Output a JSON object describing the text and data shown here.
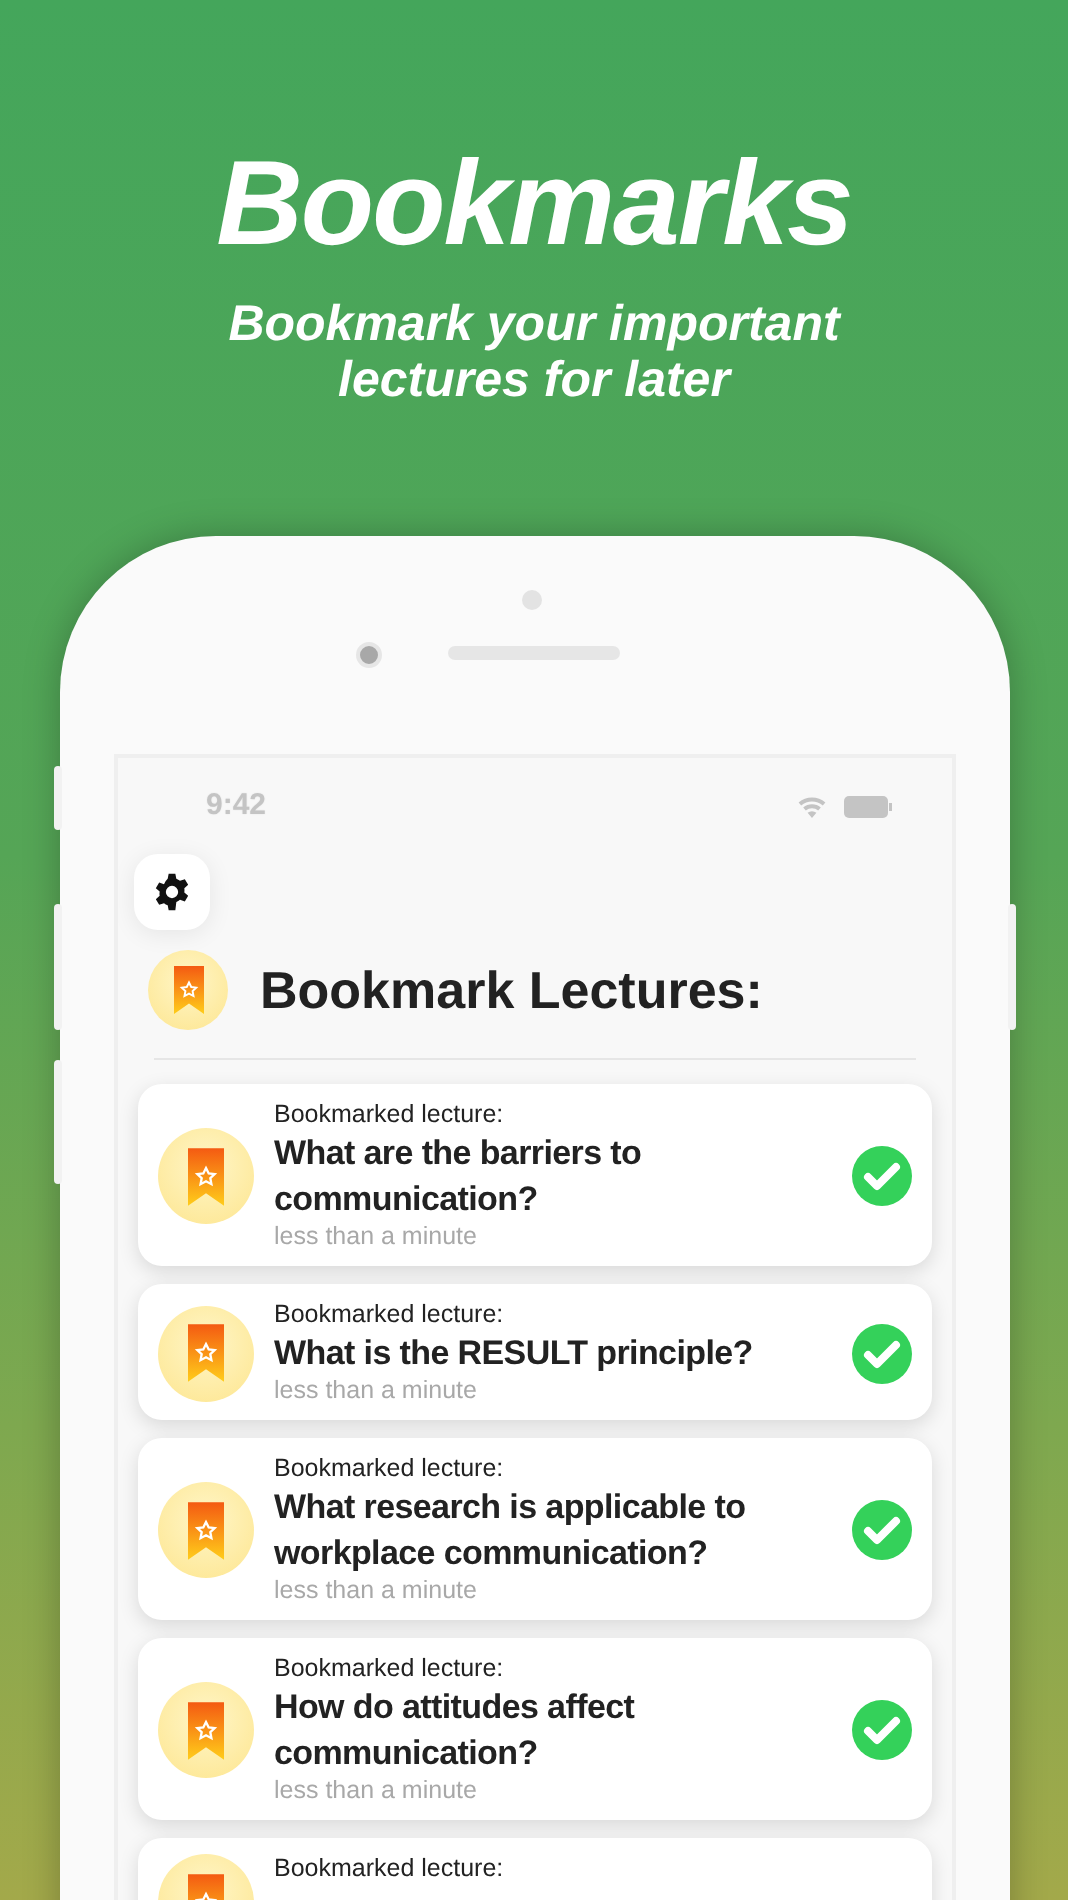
{
  "header": {
    "title": "Bookmarks",
    "subtitle": "Bookmark your important lectures for later"
  },
  "status_bar": {
    "time": "9:42"
  },
  "screen": {
    "title": "Bookmark Lectures:"
  },
  "lectures": [
    {
      "label": "Bookmarked lecture:",
      "title": "What are the barriers to communication?",
      "time": "less than a minute",
      "completed": true
    },
    {
      "label": "Bookmarked lecture:",
      "title": "What is the RESULT principle?",
      "time": "less than a minute",
      "completed": true
    },
    {
      "label": "Bookmarked lecture:",
      "title": "What research is applicable to workplace communication?",
      "time": "less than a minute",
      "completed": true
    },
    {
      "label": "Bookmarked lecture:",
      "title": "How do attitudes affect communication?",
      "time": "less than a minute",
      "completed": true
    },
    {
      "label": "Bookmarked lecture:"
    }
  ]
}
